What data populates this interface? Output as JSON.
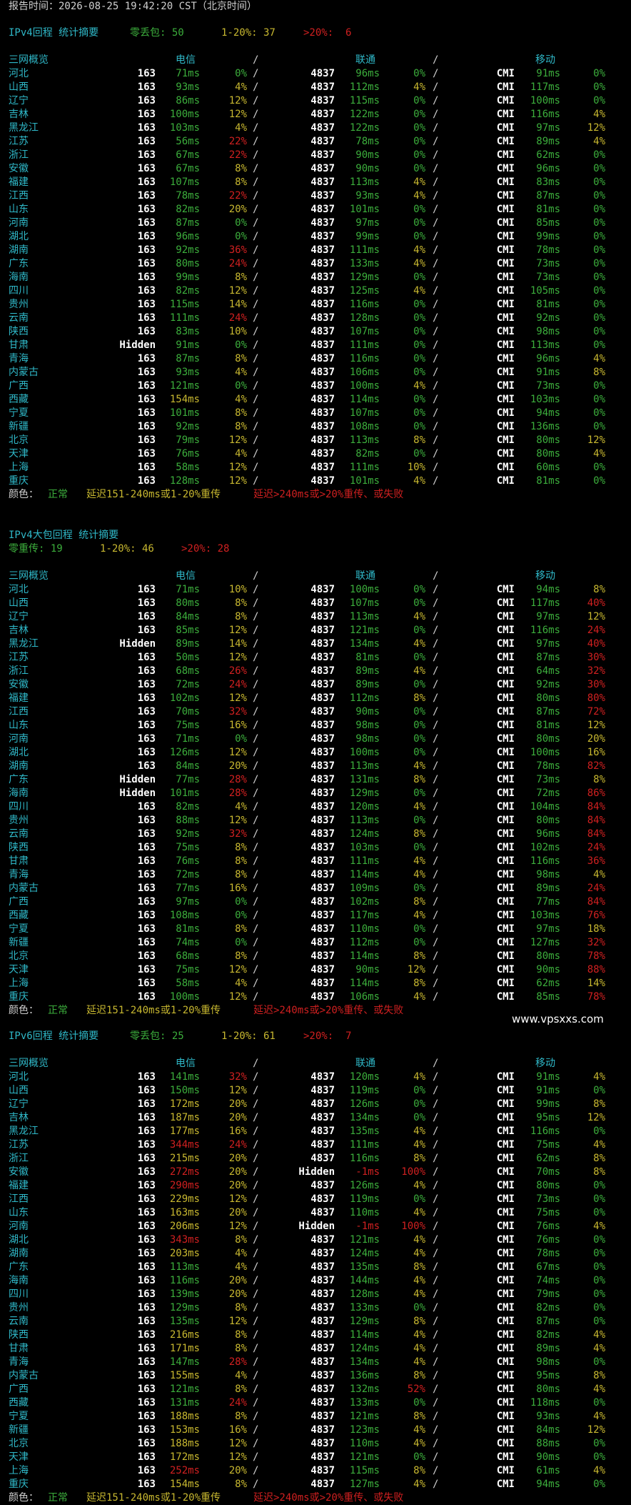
{
  "colors": {
    "fg": "#d0d0d0",
    "cyan": "#2fb8c8",
    "green": "#3cae3c",
    "yellow": "#c8b830",
    "red": "#d02020",
    "white": "#ffffff"
  },
  "report_time": "报告时间：2026-08-25 19:42:20 CST（北京时间）",
  "watermark": "www.vpsxxs.com",
  "legend": {
    "label": "颜色：",
    "normal": "正常",
    "warn": "延迟151-240ms或1-20%重传",
    "bad": "延迟>240ms或>20%重传、或失败"
  },
  "header_cols": {
    "overview": "三网概览",
    "telecom": "电信",
    "unicom": "联通",
    "mobile": "移动",
    "slash": "/"
  },
  "sections": [
    {
      "title": "IPv4回程 统计摘要",
      "summary": [
        {
          "text": "零丢包: 50",
          "color": "green"
        },
        {
          "text": "1-20%: 37",
          "color": "yellow"
        },
        {
          "text": ">20%:  6",
          "color": "red"
        }
      ],
      "rows": [
        [
          "河北",
          "163",
          "71ms",
          "0%",
          "4837",
          "96ms",
          "0%",
          "CMI",
          "91ms",
          "0%"
        ],
        [
          "山西",
          "163",
          "93ms",
          "4%",
          "4837",
          "112ms",
          "4%",
          "CMI",
          "117ms",
          "0%"
        ],
        [
          "辽宁",
          "163",
          "86ms",
          "12%",
          "4837",
          "115ms",
          "0%",
          "CMI",
          "100ms",
          "0%"
        ],
        [
          "吉林",
          "163",
          "100ms",
          "12%",
          "4837",
          "122ms",
          "0%",
          "CMI",
          "116ms",
          "4%"
        ],
        [
          "黑龙江",
          "163",
          "103ms",
          "4%",
          "4837",
          "122ms",
          "0%",
          "CMI",
          "97ms",
          "12%"
        ],
        [
          "江苏",
          "163",
          "56ms",
          "22%",
          "4837",
          "78ms",
          "0%",
          "CMI",
          "89ms",
          "4%"
        ],
        [
          "浙江",
          "163",
          "67ms",
          "22%",
          "4837",
          "90ms",
          "0%",
          "CMI",
          "62ms",
          "0%"
        ],
        [
          "安徽",
          "163",
          "67ms",
          "8%",
          "4837",
          "90ms",
          "0%",
          "CMI",
          "96ms",
          "0%"
        ],
        [
          "福建",
          "163",
          "107ms",
          "8%",
          "4837",
          "113ms",
          "4%",
          "CMI",
          "83ms",
          "0%"
        ],
        [
          "江西",
          "163",
          "78ms",
          "22%",
          "4837",
          "93ms",
          "4%",
          "CMI",
          "87ms",
          "0%"
        ],
        [
          "山东",
          "163",
          "82ms",
          "20%",
          "4837",
          "101ms",
          "0%",
          "CMI",
          "81ms",
          "0%"
        ],
        [
          "河南",
          "163",
          "87ms",
          "0%",
          "4837",
          "97ms",
          "0%",
          "CMI",
          "85ms",
          "0%"
        ],
        [
          "湖北",
          "163",
          "96ms",
          "0%",
          "4837",
          "99ms",
          "0%",
          "CMI",
          "99ms",
          "0%"
        ],
        [
          "湖南",
          "163",
          "92ms",
          "36%",
          "4837",
          "111ms",
          "4%",
          "CMI",
          "78ms",
          "0%"
        ],
        [
          "广东",
          "163",
          "80ms",
          "24%",
          "4837",
          "133ms",
          "4%",
          "CMI",
          "73ms",
          "0%"
        ],
        [
          "海南",
          "163",
          "99ms",
          "8%",
          "4837",
          "129ms",
          "0%",
          "CMI",
          "73ms",
          "0%"
        ],
        [
          "四川",
          "163",
          "82ms",
          "12%",
          "4837",
          "125ms",
          "4%",
          "CMI",
          "105ms",
          "0%"
        ],
        [
          "贵州",
          "163",
          "115ms",
          "14%",
          "4837",
          "116ms",
          "0%",
          "CMI",
          "81ms",
          "0%"
        ],
        [
          "云南",
          "163",
          "111ms",
          "24%",
          "4837",
          "128ms",
          "0%",
          "CMI",
          "92ms",
          "0%"
        ],
        [
          "陕西",
          "163",
          "83ms",
          "10%",
          "4837",
          "107ms",
          "0%",
          "CMI",
          "98ms",
          "0%"
        ],
        [
          "甘肃",
          "Hidden",
          "91ms",
          "0%",
          "4837",
          "111ms",
          "0%",
          "CMI",
          "113ms",
          "0%"
        ],
        [
          "青海",
          "163",
          "87ms",
          "8%",
          "4837",
          "116ms",
          "0%",
          "CMI",
          "96ms",
          "4%"
        ],
        [
          "内蒙古",
          "163",
          "93ms",
          "4%",
          "4837",
          "106ms",
          "0%",
          "CMI",
          "91ms",
          "8%"
        ],
        [
          "广西",
          "163",
          "121ms",
          "0%",
          "4837",
          "100ms",
          "4%",
          "CMI",
          "73ms",
          "0%"
        ],
        [
          "西藏",
          "163",
          "154ms",
          "4%",
          "4837",
          "114ms",
          "0%",
          "CMI",
          "103ms",
          "0%"
        ],
        [
          "宁夏",
          "163",
          "101ms",
          "8%",
          "4837",
          "107ms",
          "0%",
          "CMI",
          "94ms",
          "0%"
        ],
        [
          "新疆",
          "163",
          "92ms",
          "8%",
          "4837",
          "108ms",
          "0%",
          "CMI",
          "136ms",
          "0%"
        ],
        [
          "北京",
          "163",
          "79ms",
          "12%",
          "4837",
          "113ms",
          "8%",
          "CMI",
          "80ms",
          "12%"
        ],
        [
          "天津",
          "163",
          "76ms",
          "4%",
          "4837",
          "82ms",
          "0%",
          "CMI",
          "80ms",
          "4%"
        ],
        [
          "上海",
          "163",
          "58ms",
          "12%",
          "4837",
          "111ms",
          "10%",
          "CMI",
          "60ms",
          "0%"
        ],
        [
          "重庆",
          "163",
          "128ms",
          "12%",
          "4837",
          "101ms",
          "4%",
          "CMI",
          "81ms",
          "0%"
        ]
      ]
    },
    {
      "title": "IPv4大包回程 统计摘要",
      "summary": [
        {
          "text": "零重传: 19",
          "color": "green"
        },
        {
          "text": "1-20%: 46",
          "color": "yellow"
        },
        {
          "text": ">20%: 28",
          "color": "red"
        }
      ],
      "rows": [
        [
          "河北",
          "163",
          "71ms",
          "10%",
          "4837",
          "100ms",
          "0%",
          "CMI",
          "94ms",
          "8%"
        ],
        [
          "山西",
          "163",
          "80ms",
          "8%",
          "4837",
          "107ms",
          "0%",
          "CMI",
          "117ms",
          "40%"
        ],
        [
          "辽宁",
          "163",
          "84ms",
          "8%",
          "4837",
          "113ms",
          "4%",
          "CMI",
          "97ms",
          "12%"
        ],
        [
          "吉林",
          "163",
          "85ms",
          "12%",
          "4837",
          "121ms",
          "0%",
          "CMI",
          "116ms",
          "24%"
        ],
        [
          "黑龙江",
          "Hidden",
          "89ms",
          "14%",
          "4837",
          "134ms",
          "4%",
          "CMI",
          "97ms",
          "40%"
        ],
        [
          "江苏",
          "163",
          "50ms",
          "12%",
          "4837",
          "81ms",
          "0%",
          "CMI",
          "87ms",
          "30%"
        ],
        [
          "浙江",
          "163",
          "68ms",
          "26%",
          "4837",
          "89ms",
          "4%",
          "CMI",
          "64ms",
          "32%"
        ],
        [
          "安徽",
          "163",
          "72ms",
          "24%",
          "4837",
          "89ms",
          "0%",
          "CMI",
          "92ms",
          "30%"
        ],
        [
          "福建",
          "163",
          "102ms",
          "12%",
          "4837",
          "112ms",
          "8%",
          "CMI",
          "80ms",
          "80%"
        ],
        [
          "江西",
          "163",
          "70ms",
          "32%",
          "4837",
          "90ms",
          "0%",
          "CMI",
          "87ms",
          "72%"
        ],
        [
          "山东",
          "163",
          "75ms",
          "16%",
          "4837",
          "98ms",
          "0%",
          "CMI",
          "81ms",
          "12%"
        ],
        [
          "河南",
          "163",
          "71ms",
          "0%",
          "4837",
          "98ms",
          "0%",
          "CMI",
          "80ms",
          "20%"
        ],
        [
          "湖北",
          "163",
          "126ms",
          "12%",
          "4837",
          "100ms",
          "0%",
          "CMI",
          "100ms",
          "16%"
        ],
        [
          "湖南",
          "163",
          "84ms",
          "20%",
          "4837",
          "113ms",
          "4%",
          "CMI",
          "78ms",
          "82%"
        ],
        [
          "广东",
          "Hidden",
          "77ms",
          "28%",
          "4837",
          "131ms",
          "8%",
          "CMI",
          "73ms",
          "8%"
        ],
        [
          "海南",
          "Hidden",
          "101ms",
          "28%",
          "4837",
          "129ms",
          "0%",
          "CMI",
          "72ms",
          "86%"
        ],
        [
          "四川",
          "163",
          "82ms",
          "4%",
          "4837",
          "120ms",
          "4%",
          "CMI",
          "104ms",
          "84%"
        ],
        [
          "贵州",
          "163",
          "88ms",
          "12%",
          "4837",
          "113ms",
          "0%",
          "CMI",
          "80ms",
          "84%"
        ],
        [
          "云南",
          "163",
          "92ms",
          "32%",
          "4837",
          "124ms",
          "8%",
          "CMI",
          "96ms",
          "84%"
        ],
        [
          "陕西",
          "163",
          "75ms",
          "8%",
          "4837",
          "103ms",
          "0%",
          "CMI",
          "102ms",
          "24%"
        ],
        [
          "甘肃",
          "163",
          "76ms",
          "8%",
          "4837",
          "111ms",
          "4%",
          "CMI",
          "116ms",
          "36%"
        ],
        [
          "青海",
          "163",
          "72ms",
          "8%",
          "4837",
          "114ms",
          "4%",
          "CMI",
          "98ms",
          "4%"
        ],
        [
          "内蒙古",
          "163",
          "77ms",
          "16%",
          "4837",
          "109ms",
          "0%",
          "CMI",
          "89ms",
          "24%"
        ],
        [
          "广西",
          "163",
          "97ms",
          "0%",
          "4837",
          "102ms",
          "8%",
          "CMI",
          "77ms",
          "84%"
        ],
        [
          "西藏",
          "163",
          "108ms",
          "0%",
          "4837",
          "117ms",
          "4%",
          "CMI",
          "103ms",
          "76%"
        ],
        [
          "宁夏",
          "163",
          "81ms",
          "8%",
          "4837",
          "110ms",
          "0%",
          "CMI",
          "97ms",
          "18%"
        ],
        [
          "新疆",
          "163",
          "74ms",
          "0%",
          "4837",
          "112ms",
          "0%",
          "CMI",
          "127ms",
          "32%"
        ],
        [
          "北京",
          "163",
          "68ms",
          "8%",
          "4837",
          "114ms",
          "8%",
          "CMI",
          "80ms",
          "78%"
        ],
        [
          "天津",
          "163",
          "75ms",
          "12%",
          "4837",
          "90ms",
          "12%",
          "CMI",
          "90ms",
          "88%"
        ],
        [
          "上海",
          "163",
          "58ms",
          "4%",
          "4837",
          "114ms",
          "8%",
          "CMI",
          "62ms",
          "14%"
        ],
        [
          "重庆",
          "163",
          "100ms",
          "12%",
          "4837",
          "106ms",
          "4%",
          "CMI",
          "85ms",
          "78%"
        ]
      ]
    },
    {
      "title": "IPv6回程 统计摘要",
      "summary": [
        {
          "text": "零丢包: 25",
          "color": "green"
        },
        {
          "text": "1-20%: 61",
          "color": "yellow"
        },
        {
          "text": ">20%:  7",
          "color": "red"
        }
      ],
      "rows": [
        [
          "河北",
          "163",
          "141ms",
          "32%",
          "4837",
          "120ms",
          "4%",
          "CMI",
          "91ms",
          "4%"
        ],
        [
          "山西",
          "163",
          "150ms",
          "12%",
          "4837",
          "119ms",
          "0%",
          "CMI",
          "91ms",
          "0%"
        ],
        [
          "辽宁",
          "163",
          "172ms",
          "20%",
          "4837",
          "126ms",
          "0%",
          "CMI",
          "99ms",
          "8%"
        ],
        [
          "吉林",
          "163",
          "187ms",
          "20%",
          "4837",
          "134ms",
          "0%",
          "CMI",
          "95ms",
          "12%"
        ],
        [
          "黑龙江",
          "163",
          "177ms",
          "16%",
          "4837",
          "135ms",
          "4%",
          "CMI",
          "116ms",
          "0%"
        ],
        [
          "江苏",
          "163",
          "344ms",
          "24%",
          "4837",
          "111ms",
          "4%",
          "CMI",
          "75ms",
          "4%"
        ],
        [
          "浙江",
          "163",
          "215ms",
          "20%",
          "4837",
          "116ms",
          "8%",
          "CMI",
          "62ms",
          "8%"
        ],
        [
          "安徽",
          "163",
          "272ms",
          "20%",
          "Hidden",
          "-1ms",
          "100%",
          "CMI",
          "70ms",
          "8%"
        ],
        [
          "福建",
          "163",
          "290ms",
          "20%",
          "4837",
          "126ms",
          "4%",
          "CMI",
          "80ms",
          "0%"
        ],
        [
          "江西",
          "163",
          "229ms",
          "12%",
          "4837",
          "119ms",
          "0%",
          "CMI",
          "73ms",
          "0%"
        ],
        [
          "山东",
          "163",
          "163ms",
          "20%",
          "4837",
          "110ms",
          "4%",
          "CMI",
          "75ms",
          "0%"
        ],
        [
          "河南",
          "163",
          "206ms",
          "12%",
          "Hidden",
          "-1ms",
          "100%",
          "CMI",
          "76ms",
          "4%"
        ],
        [
          "湖北",
          "163",
          "343ms",
          "8%",
          "4837",
          "121ms",
          "4%",
          "CMI",
          "76ms",
          "0%"
        ],
        [
          "湖南",
          "163",
          "203ms",
          "4%",
          "4837",
          "124ms",
          "4%",
          "CMI",
          "78ms",
          "0%"
        ],
        [
          "广东",
          "163",
          "113ms",
          "4%",
          "4837",
          "135ms",
          "8%",
          "CMI",
          "67ms",
          "0%"
        ],
        [
          "海南",
          "163",
          "116ms",
          "20%",
          "4837",
          "144ms",
          "4%",
          "CMI",
          "74ms",
          "0%"
        ],
        [
          "四川",
          "163",
          "139ms",
          "20%",
          "4837",
          "128ms",
          "4%",
          "CMI",
          "79ms",
          "0%"
        ],
        [
          "贵州",
          "163",
          "129ms",
          "8%",
          "4837",
          "133ms",
          "0%",
          "CMI",
          "82ms",
          "0%"
        ],
        [
          "云南",
          "163",
          "135ms",
          "12%",
          "4837",
          "129ms",
          "8%",
          "CMI",
          "87ms",
          "0%"
        ],
        [
          "陕西",
          "163",
          "216ms",
          "8%",
          "4837",
          "114ms",
          "4%",
          "CMI",
          "82ms",
          "4%"
        ],
        [
          "甘肃",
          "163",
          "171ms",
          "8%",
          "4837",
          "124ms",
          "4%",
          "CMI",
          "89ms",
          "4%"
        ],
        [
          "青海",
          "163",
          "147ms",
          "28%",
          "4837",
          "134ms",
          "4%",
          "CMI",
          "98ms",
          "0%"
        ],
        [
          "内蒙古",
          "163",
          "155ms",
          "4%",
          "4837",
          "136ms",
          "8%",
          "CMI",
          "95ms",
          "8%"
        ],
        [
          "广西",
          "163",
          "121ms",
          "8%",
          "4837",
          "132ms",
          "52%",
          "CMI",
          "80ms",
          "4%"
        ],
        [
          "西藏",
          "163",
          "131ms",
          "24%",
          "4837",
          "133ms",
          "0%",
          "CMI",
          "118ms",
          "0%"
        ],
        [
          "宁夏",
          "163",
          "188ms",
          "8%",
          "4837",
          "121ms",
          "8%",
          "CMI",
          "93ms",
          "4%"
        ],
        [
          "新疆",
          "163",
          "153ms",
          "16%",
          "4837",
          "123ms",
          "4%",
          "CMI",
          "84ms",
          "12%"
        ],
        [
          "北京",
          "163",
          "188ms",
          "12%",
          "4837",
          "110ms",
          "4%",
          "CMI",
          "88ms",
          "0%"
        ],
        [
          "天津",
          "163",
          "172ms",
          "12%",
          "4837",
          "121ms",
          "0%",
          "CMI",
          "90ms",
          "0%"
        ],
        [
          "上海",
          "163",
          "252ms",
          "20%",
          "4837",
          "115ms",
          "8%",
          "CMI",
          "61ms",
          "4%"
        ],
        [
          "重庆",
          "163",
          "154ms",
          "8%",
          "4837",
          "127ms",
          "4%",
          "CMI",
          "94ms",
          "0%"
        ]
      ]
    }
  ]
}
